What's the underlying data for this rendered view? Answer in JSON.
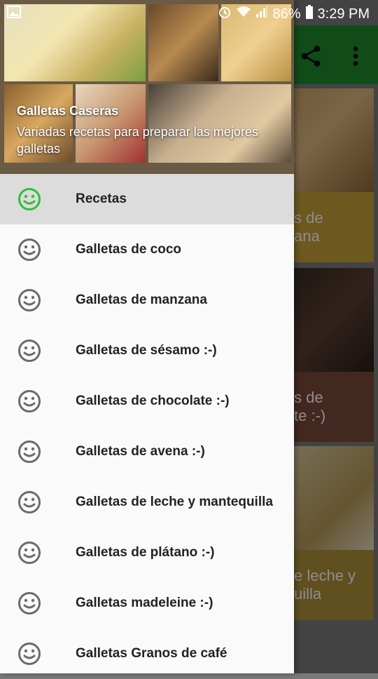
{
  "status_bar": {
    "battery": "86%",
    "time": "3:29 PM"
  },
  "drawer": {
    "header_title": "Galletas Caseras",
    "header_subtitle": "Variadas recetas para preparar las mejores galletas",
    "items": [
      {
        "label": "Recetas",
        "active": true
      },
      {
        "label": "Galletas de coco"
      },
      {
        "label": "Galletas de manzana"
      },
      {
        "label": "Galletas de sésamo :-)"
      },
      {
        "label": "Galletas de chocolate :-)"
      },
      {
        "label": "Galletas de avena :-)"
      },
      {
        "label": "Galletas de leche y mantequilla"
      },
      {
        "label": "Galletas de plátano :-)"
      },
      {
        "label": "Galletas madeleine :-)"
      },
      {
        "label": "Galletas Granos de café"
      }
    ]
  },
  "background_cards": [
    {
      "line1": "s de",
      "line2": "ana"
    },
    {
      "line1": "s de",
      "line2": "te :-)"
    },
    {
      "line1": "e leche y",
      "line2": "uilla"
    }
  ],
  "colors": {
    "toolbar": "#1f8a2d",
    "active_icon": "#2fbf3a",
    "icon": "#6b6b6b"
  }
}
